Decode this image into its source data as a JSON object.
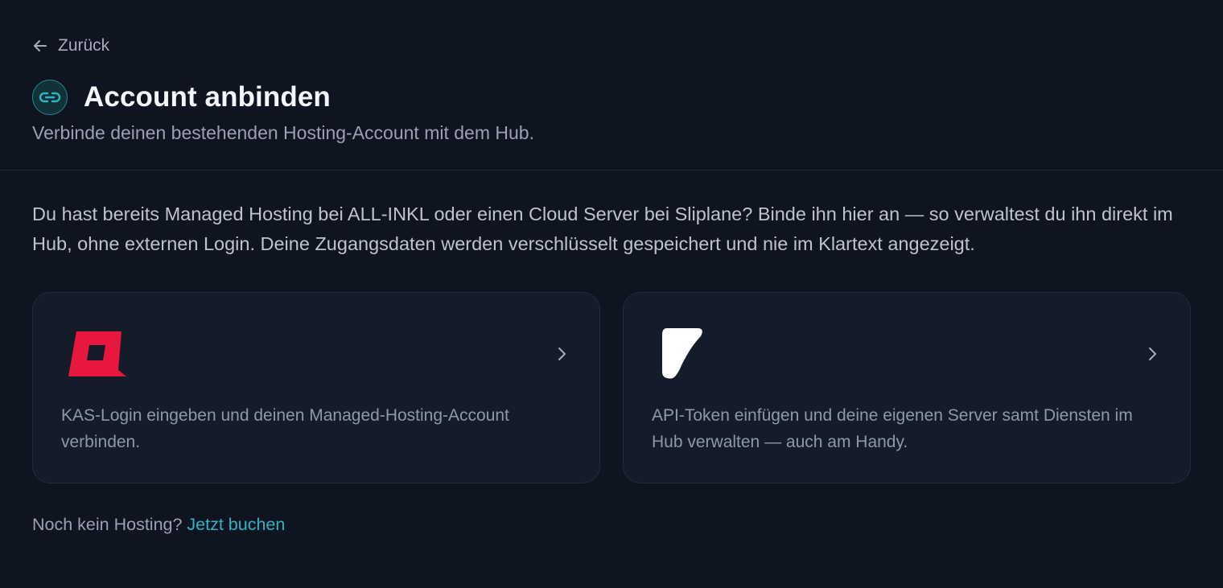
{
  "nav": {
    "back_label": "Zurück"
  },
  "header": {
    "title": "Account anbinden",
    "subtitle": "Verbinde deinen bestehenden Hosting-Account mit dem Hub.",
    "icon": "link-icon"
  },
  "intro": {
    "text": "Du hast bereits Managed Hosting bei ALL-INKL oder einen Cloud Server bei Sliplane? Binde ihn hier an — so verwaltest du ihn direkt im Hub, ohne externen Login. Deine Zugangsdaten werden verschlüsselt gespeichert und nie im Klartext angezeigt."
  },
  "providers": [
    {
      "logo": "all-inkl-logo",
      "description": "KAS-Login eingeben und deinen Managed-Hosting-Account verbinden.",
      "logo_color": "#e8173f"
    },
    {
      "logo": "sliplane-logo",
      "description": "API-Token einfügen und deine eigenen Server samt Diensten im Hub verwalten — auch am Handy.",
      "logo_color": "#ffffff"
    }
  ],
  "footer": {
    "question": "Noch kein Hosting?",
    "link_label": "Jetzt buchen"
  },
  "colors": {
    "background": "#0e1420",
    "card_background": "#141c29",
    "accent": "#2fb3c2"
  }
}
